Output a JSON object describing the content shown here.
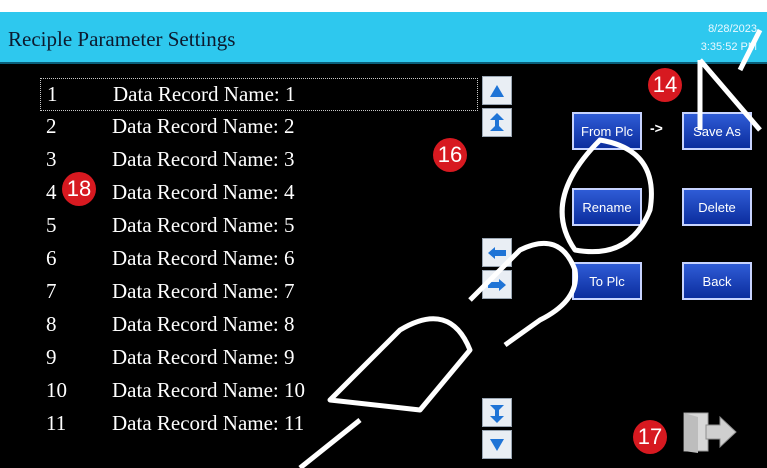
{
  "header": {
    "title": "Reciple Parameter Settings",
    "date": "8/28/2023",
    "time": "3:35:52 PM"
  },
  "records": [
    {
      "num": "1",
      "name": "Data Record Name: 1"
    },
    {
      "num": "2",
      "name": "Data Record Name: 2"
    },
    {
      "num": "3",
      "name": "Data Record Name: 3"
    },
    {
      "num": "4",
      "name": "Data Record Name: 4"
    },
    {
      "num": "5",
      "name": "Data Record Name: 5"
    },
    {
      "num": "6",
      "name": "Data Record Name: 6"
    },
    {
      "num": "7",
      "name": "Data Record Name: 7"
    },
    {
      "num": "8",
      "name": "Data Record Name: 8"
    },
    {
      "num": "9",
      "name": "Data Record Name: 9"
    },
    {
      "num": "10",
      "name": "Data Record Name: 10"
    },
    {
      "num": "11",
      "name": "Data Record Name: 11"
    }
  ],
  "selected_record": "1",
  "buttons": {
    "from_plc": "From Plc",
    "save_as": "Save As",
    "rename": "Rename",
    "delete": "Delete",
    "to_plc": "To Plc",
    "back": "Back",
    "arrow_text": "->"
  },
  "badges": {
    "b14": "14",
    "b16": "16",
    "b17": "17",
    "b18": "18"
  },
  "icons": {
    "scroll_up": "triangle-up-icon",
    "page_up": "double-chevron-up-icon",
    "left": "arrow-left-icon",
    "right": "arrow-right-icon",
    "page_down": "double-chevron-down-icon",
    "scroll_down": "triangle-down-icon",
    "exit": "exit-door-icon"
  },
  "colors": {
    "header_bg": "#2ec8ee",
    "button_blue": "#1a43c0",
    "badge_red": "#d71920",
    "background": "#000000"
  }
}
